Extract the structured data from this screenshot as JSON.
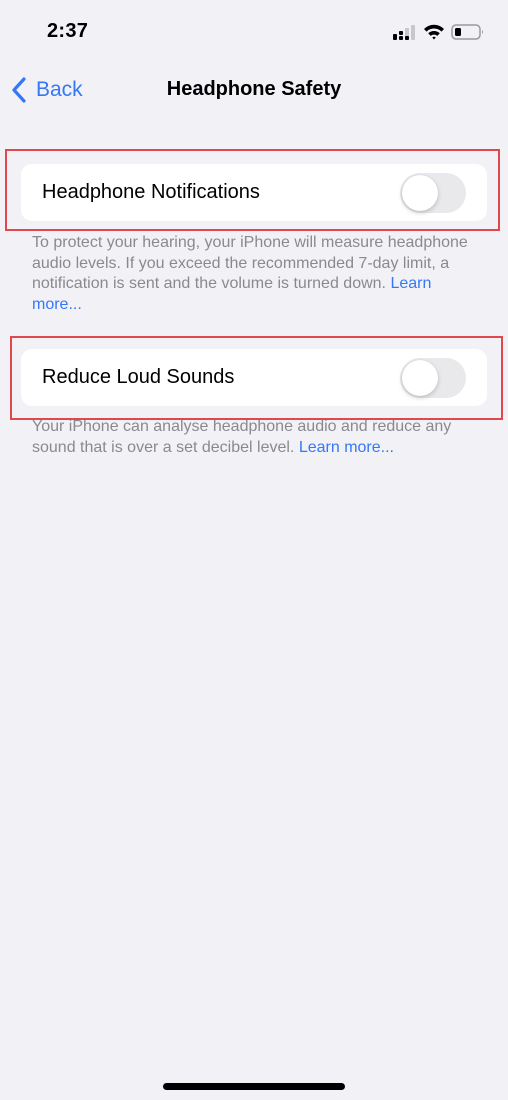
{
  "status_bar": {
    "time": "2:37",
    "icons": [
      "cellular-signal-icon",
      "wifi-icon",
      "battery-icon"
    ],
    "battery_level": 0.25
  },
  "nav": {
    "back_label": "Back",
    "back_icon": "chevron-left-icon",
    "title": "Headphone Safety"
  },
  "settings": [
    {
      "label": "Headphone Notifications",
      "enabled": false,
      "footer": "To protect your hearing, your iPhone will measure headphone audio levels. If you exceed the recommended 7-day limit, a notification is sent and the volume is turned down. ",
      "footer_link": "Learn more..."
    },
    {
      "label": "Reduce Loud Sounds",
      "enabled": false,
      "footer": "Your iPhone can analyse headphone audio and reduce any sound that is over a set decibel level. ",
      "footer_link": "Learn more..."
    }
  ],
  "colors": {
    "accent": "#3478f6",
    "background": "#f2f1f6",
    "toggle_off": "#e9e9eb",
    "footer_text": "#8a8a8e",
    "highlight": "#e0484c"
  }
}
